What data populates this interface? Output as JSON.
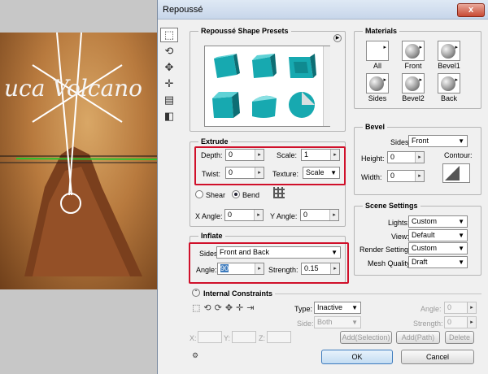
{
  "window": {
    "title": "Repoussé",
    "close": "x"
  },
  "canvas_text": "uca Volcano",
  "tools": [
    "select-object-icon",
    "rotate-icon",
    "move-icon",
    "scale-icon",
    "slide-icon",
    "camera-icon"
  ],
  "presets": {
    "title": "Repoussé Shape Presets",
    "menu": "▶"
  },
  "materials": {
    "title": "Materials",
    "items": [
      "All",
      "Front",
      "Bevel1",
      "Sides",
      "Bevel2",
      "Back"
    ]
  },
  "extrude": {
    "title": "Extrude",
    "depth_label": "Depth:",
    "depth": "0",
    "scale_label": "Scale:",
    "scale": "1",
    "twist_label": "Twist:",
    "twist": "0",
    "texture_label": "Texture:",
    "texture": "Scale",
    "shear": "Shear",
    "bend": "Bend",
    "xangle_label": "X Angle:",
    "xangle": "0",
    "yangle_label": "Y Angle:",
    "yangle": "0"
  },
  "inflate": {
    "title": "Inflate",
    "sides_label": "Sides:",
    "sides": "Front and Back",
    "angle_label": "Angle:",
    "angle": "90",
    "strength_label": "Strength:",
    "strength": "0.15"
  },
  "bevel": {
    "title": "Bevel",
    "sides_label": "Sides:",
    "sides": "Front",
    "height_label": "Height:",
    "height": "0",
    "width_label": "Width:",
    "width": "0",
    "contour_label": "Contour:"
  },
  "scene": {
    "title": "Scene Settings",
    "lights_label": "Lights:",
    "lights": "Custom",
    "view_label": "View:",
    "view": "Default",
    "render_label": "Render Settings:",
    "render": "Custom",
    "mesh_label": "Mesh Quality:",
    "mesh": "Draft"
  },
  "constraints": {
    "title": "Internal Constraints",
    "type_label": "Type:",
    "type": "Inactive",
    "side_label": "Side:",
    "side": "Both",
    "angle_label": "Angle:",
    "angle": "0",
    "strength_label": "Strength:",
    "strength": "0",
    "x_label": "X:",
    "y_label": "Y:",
    "z_label": "Z:",
    "add_selection": "Add(Selection)",
    "add_path": "Add(Path)",
    "delete": "Delete"
  },
  "buttons": {
    "ok": "OK",
    "cancel": "Cancel"
  },
  "colors": {
    "highlight": "#d0102a",
    "shape": "#17a9b0"
  }
}
